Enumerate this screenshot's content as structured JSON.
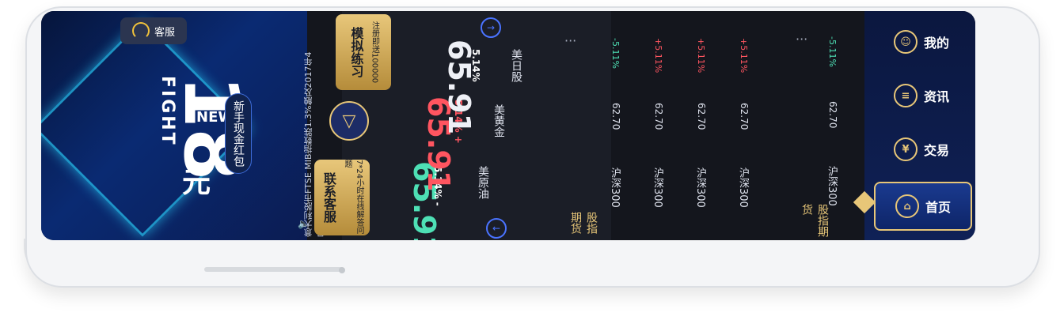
{
  "banner": {
    "service_label": "客服",
    "big_number": "18",
    "fight_text": "FIGHT",
    "new_text": "NEW",
    "yuan_text": "元",
    "promo_pill": "新手现金红包",
    "marquee": "意大利股市FTSE MIB指数跌1.3%触及2017年4月..."
  },
  "cards": {
    "contact_title": "联系客服",
    "contact_sub": "7*24小时在线解答问题",
    "sim_title": "模拟练习",
    "sim_sub": "注册即送100000"
  },
  "quotes": [
    {
      "name": "美原油",
      "price": "65.91",
      "change": "5.14% -",
      "color": "#4ee0b5"
    },
    {
      "name": "美黄金",
      "price": "65.91",
      "change": "5.14% +",
      "color": "#ff5560"
    },
    {
      "name": "美日股",
      "price": "65.91",
      "change": "5.14%",
      "color": "#eef0f6"
    }
  ],
  "table": {
    "header": "股指期货",
    "rows": [
      {
        "name": "沪深300",
        "value": "62.70",
        "change": "-5.11%",
        "color": "#4ee0b5"
      },
      {
        "name": "沪深300",
        "value": "62.70",
        "change": "+5.11%",
        "color": "#ff5560"
      },
      {
        "name": "沪深300",
        "value": "62.70",
        "change": "+5.11%",
        "color": "#ff5560"
      },
      {
        "name": "沪深300",
        "value": "62.70",
        "change": "+5.11%",
        "color": "#ff5560"
      }
    ],
    "more": "···"
  },
  "table2": {
    "header": "股指期货",
    "row": {
      "name": "沪深300",
      "value": "62.70",
      "change": "-5.11%",
      "color": "#4ee0b5"
    },
    "more": "···"
  },
  "nav": [
    {
      "label": "首页",
      "icon": "home-icon"
    },
    {
      "label": "交易",
      "icon": "yen-icon"
    },
    {
      "label": "资讯",
      "icon": "news-icon"
    },
    {
      "label": "我的",
      "icon": "user-icon"
    }
  ]
}
